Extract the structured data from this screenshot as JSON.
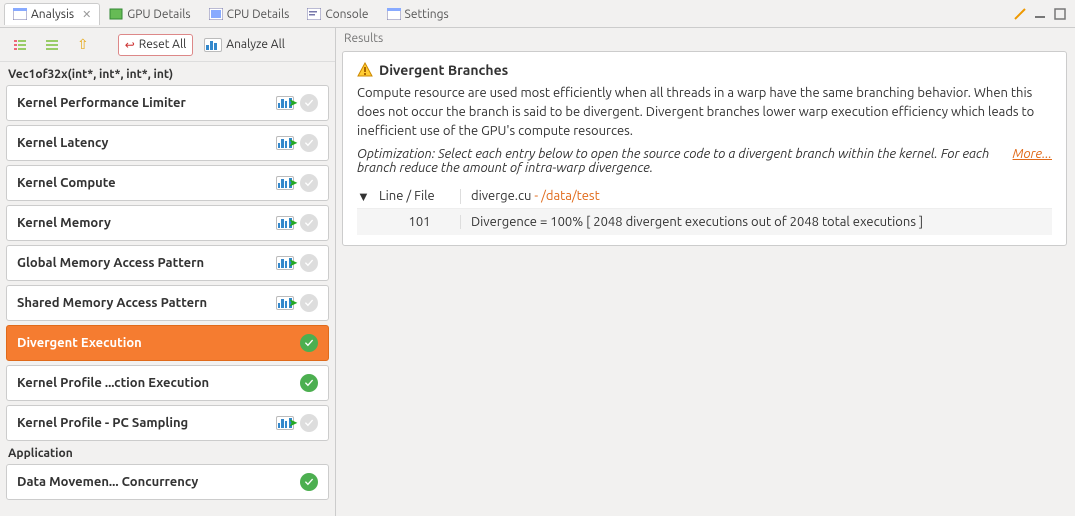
{
  "tabs": {
    "analysis": "Analysis",
    "gpu": "GPU Details",
    "cpu": "CPU Details",
    "console": "Console",
    "settings": "Settings"
  },
  "toolbar": {
    "reset_all": "Reset All",
    "analyze_all": "Analyze All"
  },
  "left_title": "Vec1of32x(int*, int*, int*, int)",
  "items": [
    {
      "label": "Kernel Performance Limiter",
      "status": "gray",
      "chart": true
    },
    {
      "label": "Kernel Latency",
      "status": "gray",
      "chart": true
    },
    {
      "label": "Kernel Compute",
      "status": "gray",
      "chart": true
    },
    {
      "label": "Kernel Memory",
      "status": "gray",
      "chart": true
    },
    {
      "label": "Global Memory Access Pattern",
      "status": "gray",
      "chart": true
    },
    {
      "label": "Shared Memory Access Pattern",
      "status": "gray",
      "chart": true
    },
    {
      "label": "Divergent Execution",
      "status": "green-sel",
      "chart": false,
      "selected": true
    },
    {
      "label": "Kernel Profile ...ction Execution",
      "status": "green",
      "chart": false
    },
    {
      "label": "Kernel Profile - PC Sampling",
      "status": "gray",
      "chart": true
    }
  ],
  "app_section": "Application",
  "app_items": [
    {
      "label": "Data Movemen... Concurrency",
      "status": "green",
      "chart": false
    }
  ],
  "results": {
    "section_label": "Results",
    "title": "Divergent Branches",
    "body": "Compute resource are used most efficiently when all threads in a warp have the same branching behavior. When this does not occur the branch is said to be divergent. Divergent branches lower warp execution efficiency which leads to inefficient use of the GPU's compute resources.",
    "optimization": "Optimization: Select each entry below to open the source code to a divergent branch within the kernel. For each branch reduce the amount of intra-warp divergence.",
    "more": "More...",
    "table": {
      "hdr_line": "Line / File",
      "hdr_file": "diverge.cu",
      "hdr_path": " - /data/test",
      "row_line": "101",
      "row_desc": "Divergence = 100% [ 2048 divergent executions out of 2048 total executions ]"
    }
  }
}
